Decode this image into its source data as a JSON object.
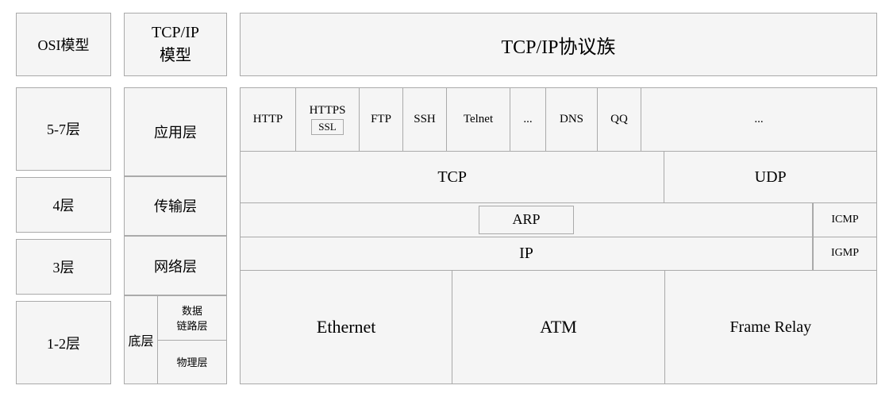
{
  "header": {
    "osi_label": "OSI模型",
    "tcpip_model_label": "TCP/IP\n模型",
    "suite_label": "TCP/IP协议族"
  },
  "osi_layers": [
    {
      "label": "5-7层"
    },
    {
      "label": "4层"
    },
    {
      "label": "3层"
    },
    {
      "label": "1-2层"
    }
  ],
  "tcpip_layers": [
    {
      "label": "应用层"
    },
    {
      "label": "传输层"
    },
    {
      "label": "网络层"
    },
    {
      "label_main": "底层",
      "label_sub1": "数据\n链路层",
      "label_sub2": "物理层"
    }
  ],
  "protocols": {
    "app_row": [
      {
        "label": "HTTP"
      },
      {
        "label": "HTTPS",
        "sub": "SSL"
      },
      {
        "label": "FTP"
      },
      {
        "label": "SSH"
      },
      {
        "label": "Telnet"
      },
      {
        "label": "..."
      },
      {
        "label": "DNS"
      },
      {
        "label": "QQ"
      },
      {
        "label": "..."
      }
    ],
    "transport_row": {
      "tcp": "TCP",
      "udp": "UDP"
    },
    "network_row": {
      "arp": "ARP",
      "ip": "IP",
      "icmp": "ICMP",
      "igmp": "IGMP"
    },
    "link_row": {
      "ethernet": "Ethernet",
      "atm": "ATM",
      "frame_relay": "Frame Relay"
    }
  }
}
